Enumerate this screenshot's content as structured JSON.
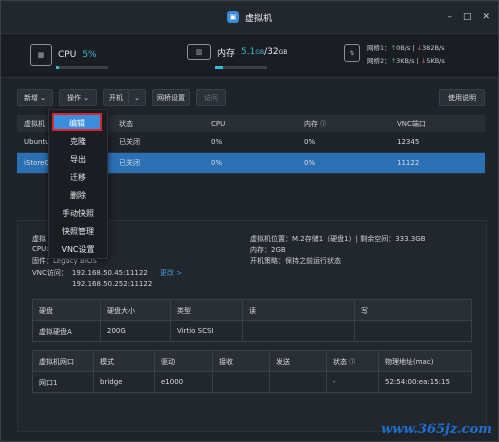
{
  "window": {
    "title": "虚拟机",
    "controls": [
      "–",
      "□",
      "✕"
    ]
  },
  "stats": {
    "cpu": {
      "label": "CPU",
      "value": "5%",
      "fill": 0.05
    },
    "memory": {
      "label": "内存",
      "used": "5.1",
      "unit1": "GB",
      "sep": "/",
      "total": "32",
      "unit2": "GB",
      "fill": 0.16
    },
    "network": [
      {
        "name": "网桥1：",
        "up": "0B/s",
        "down": "382B/s"
      },
      {
        "name": "网桥2：",
        "up": "3KB/s",
        "down": "5KB/s"
      }
    ]
  },
  "toolbar": {
    "new": "新增",
    "ops": "操作",
    "power": "开机",
    "net_settings": "网桥设置",
    "access": "访问",
    "help": "使用说明"
  },
  "vm_table": {
    "headers": [
      "虚拟机",
      "状态",
      "CPU",
      "内存",
      "VNC端口"
    ],
    "rows": [
      {
        "name": "Ubuntu",
        "status": "已关闭",
        "cpu": "0%",
        "mem": "0%",
        "vnc": "12345"
      },
      {
        "name": "iStoreOS",
        "status": "已关闭",
        "cpu": "0%",
        "mem": "0%",
        "vnc": "11122"
      }
    ]
  },
  "context_menu": [
    "编辑",
    "克隆",
    "导出",
    "迁移",
    "删除",
    "手动快照",
    "快照管理",
    "VNC设置"
  ],
  "detail": {
    "name_label": "虚拟",
    "cpu_label": "CPU:",
    "firmware": "固件：Legacy BIOS",
    "vnc_label": "VNC访问：",
    "vnc_addr1": "192.168.50.45:11122",
    "vnc_addr2": "192.168.50.252:11122",
    "change_link": "更改 >",
    "location": "虚拟机位置：M.2存储1（硬盘1）| 剩余空间：333.3GB",
    "memory": "内存：2GB",
    "power_policy": "开机策略：保持之前运行状态"
  },
  "disk_table": {
    "headers": [
      "硬盘",
      "硬盘大小",
      "类型",
      "读",
      "写"
    ],
    "rows": [
      {
        "disk": "虚拟硬盘A",
        "size": "200G",
        "type": "Virtio SCSI",
        "read": "",
        "write": ""
      }
    ]
  },
  "nic_table": {
    "headers": [
      "虚拟机网口",
      "模式",
      "驱动",
      "接收",
      "发送",
      "状态",
      "物理地址(mac)"
    ],
    "rows": [
      {
        "port": "网口1",
        "mode": "bridge",
        "driver": "e1000",
        "rx": "",
        "tx": "",
        "status": "-",
        "mac": "52:54:00:ea:15:15"
      }
    ]
  },
  "watermark": "www.365jz.com",
  "colors": {
    "accent": "#38b9d6",
    "selected": "#3a8edb",
    "highlight": "#d8262c"
  }
}
